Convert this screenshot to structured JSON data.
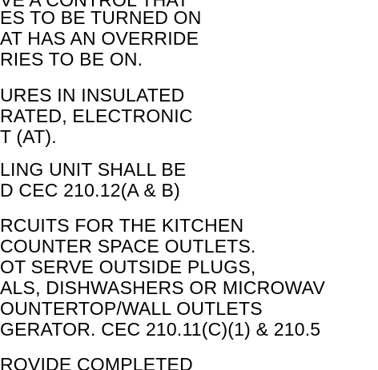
{
  "document": {
    "lines": [
      "VE A CONTROL THAT",
      "ES TO BE TURNED ON",
      "AT HAS AN OVERRIDE",
      "RIES TO BE ON.",
      "URES IN INSULATED",
      "RATED, ELECTRONIC",
      "T (AT).",
      "LING UNIT SHALL BE",
      "D CEC 210.12(A & B)",
      "RCUITS FOR THE KITCHEN",
      " COUNTER SPACE OUTLETS.",
      "OT SERVE OUTSIDE PLUGS,",
      "ALS, DISHWASHERS OR MICROWAV",
      "OUNTERTOP/WALL OUTLETS",
      "GERATOR.  CEC 210.11(C)(1) & 210.5",
      "ROVIDE COMPLETED"
    ]
  }
}
